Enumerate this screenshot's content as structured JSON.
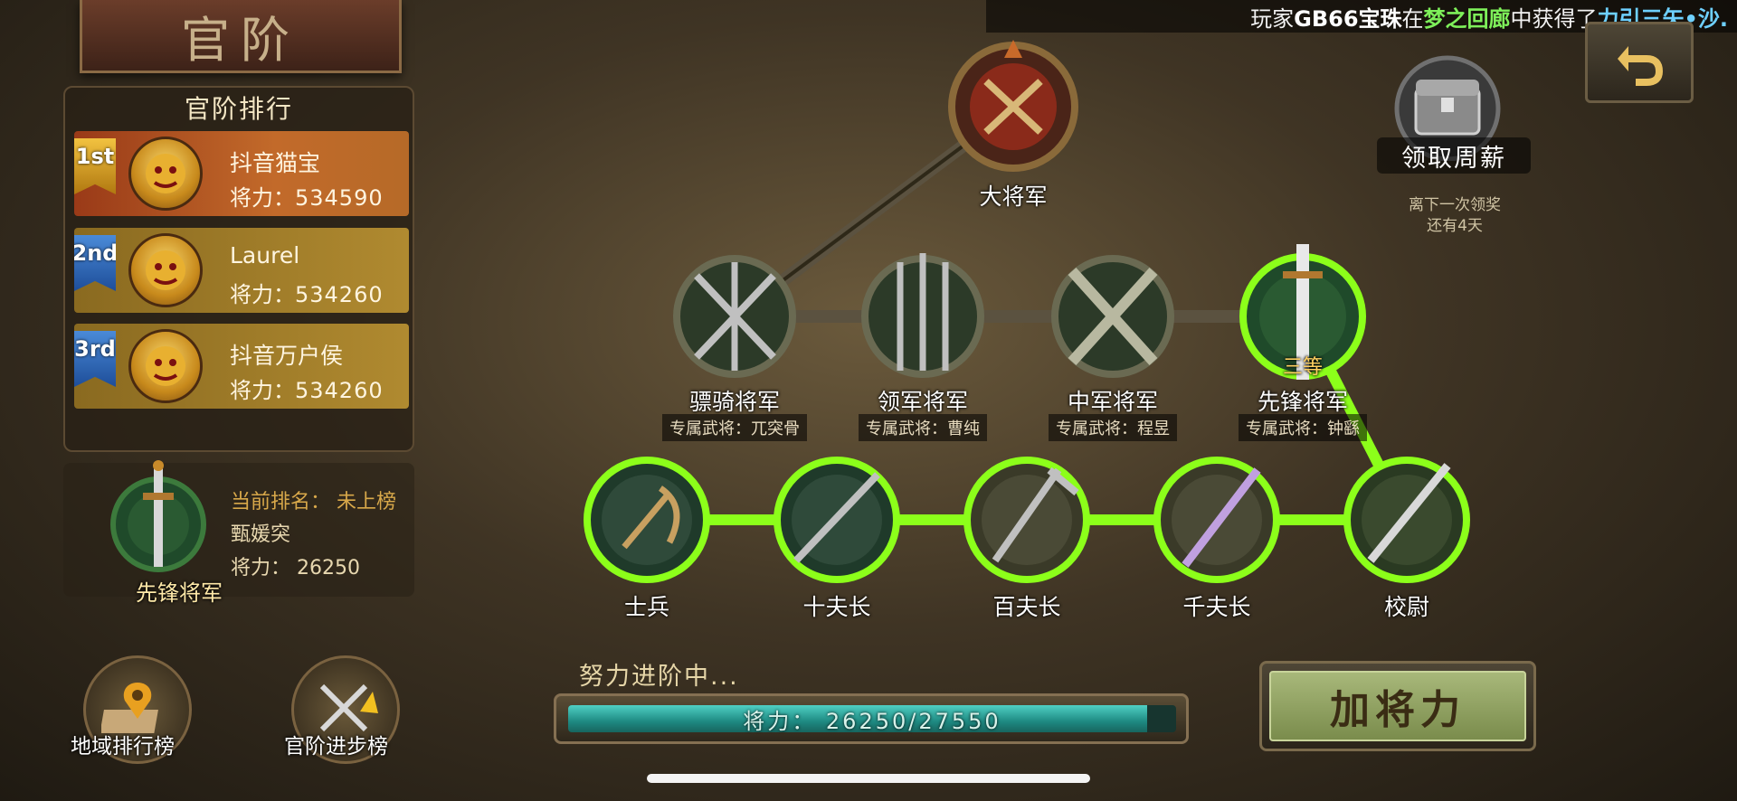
{
  "ticker": {
    "prefix": "玩家",
    "player": "GB66宝珠",
    "mid": "在",
    "location": "梦之回廊",
    "mid2": "中获得了",
    "item": "力引三矢•沙."
  },
  "title": "官阶",
  "ranking": {
    "header": "官阶排行",
    "entries": [
      {
        "badge": "1st",
        "name": "抖音猫宝",
        "power_label": "将力：",
        "power": "534590"
      },
      {
        "badge": "2nd",
        "name": "Laurel",
        "power_label": "将力：",
        "power": "534260"
      },
      {
        "badge": "3rd",
        "name": "抖音万户侯",
        "power_label": "将力：",
        "power": "534260"
      }
    ]
  },
  "me": {
    "rank_label": "先锋将军",
    "status": "当前排名：  未上榜",
    "name": "甄媛突",
    "power": "将力：  26250"
  },
  "bottom_buttons": {
    "region": "地域排行榜",
    "promotion": "官阶进步榜"
  },
  "ranks": {
    "top": {
      "name": "大将军"
    },
    "middle": [
      {
        "name": "骠骑将军",
        "general": "专属武将：兀突骨"
      },
      {
        "name": "领军将军",
        "general": "专属武将：曹纯"
      },
      {
        "name": "中军将军",
        "general": "专属武将：程昱"
      },
      {
        "name": "先锋将军",
        "general": "专属武将：钟繇",
        "grade": "三等"
      }
    ],
    "bottom": [
      {
        "name": "士兵"
      },
      {
        "name": "十夫长"
      },
      {
        "name": "百夫长"
      },
      {
        "name": "千夫长"
      },
      {
        "name": "校尉"
      }
    ]
  },
  "salary": {
    "label": "领取周薪",
    "note_line1": "离下一次领奖",
    "note_line2": "还有4天"
  },
  "progress": {
    "caption": "努力进阶中...",
    "text": "将力：  26250/27550",
    "fraction": 0.9528
  },
  "add_power_button": "加将力",
  "colors": {
    "path_active": "#8cff1a",
    "path_inactive": "#5b5240",
    "teal_fill": "#2aa89c"
  }
}
